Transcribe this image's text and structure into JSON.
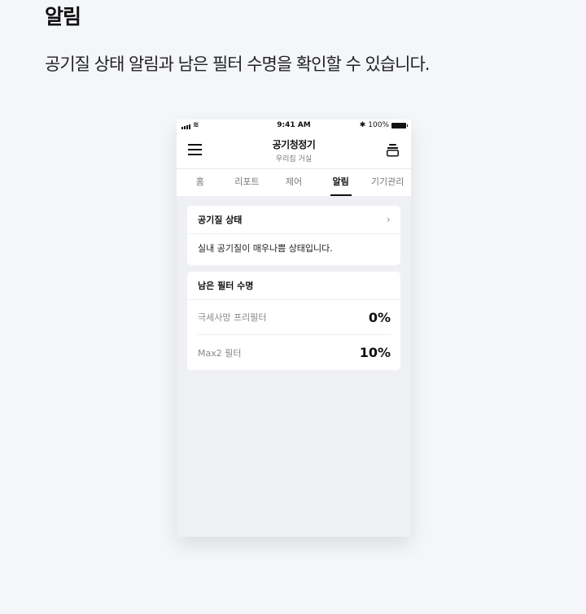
{
  "heading": "알림",
  "description": "공기질 상태 알림과 남은 필터 수명을 확인할 수 있습니다.",
  "status_bar": {
    "time": "9:41 AM",
    "bluetooth": "✱",
    "battery": "100%"
  },
  "app": {
    "title": "공기청정기",
    "subtitle": "우리집 거실"
  },
  "tabs": [
    {
      "label": "홈"
    },
    {
      "label": "리포트"
    },
    {
      "label": "제어"
    },
    {
      "label": "알림"
    },
    {
      "label": "기기관리"
    }
  ],
  "active_tab": "알림",
  "air_quality": {
    "title": "공기질 상태",
    "message": "실내 공기질이 매우나쁨 상태입니다."
  },
  "filter_life": {
    "title": "남은 필터 수명",
    "items": [
      {
        "label": "극세사망 프리필터",
        "value": "0%"
      },
      {
        "label": "Max2 필터",
        "value": "10%"
      }
    ]
  }
}
